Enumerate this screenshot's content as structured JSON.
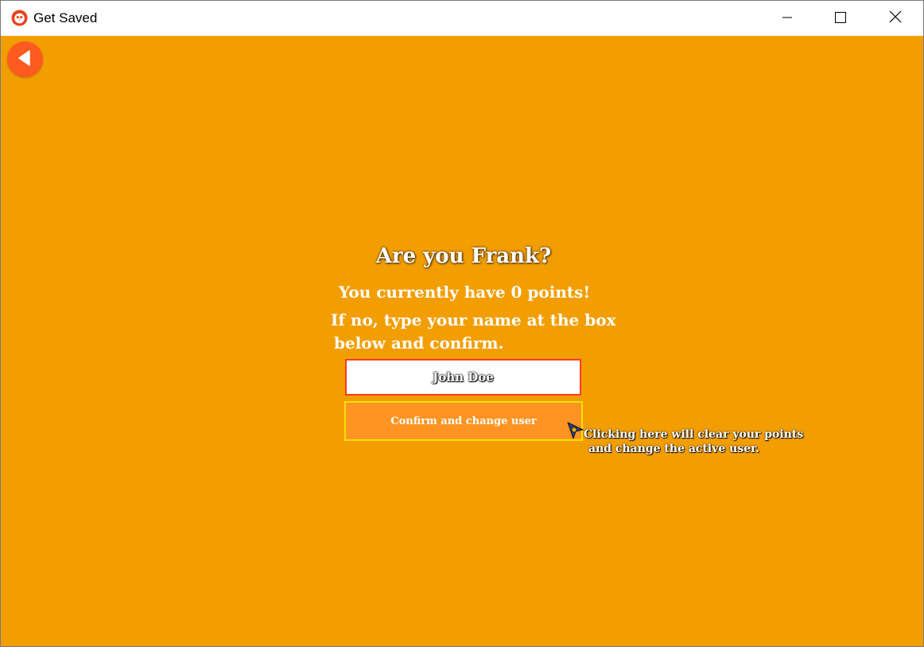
{
  "window": {
    "title": "Get Saved",
    "app_icon": "owl-logo-icon",
    "controls": [
      "minimize-icon",
      "maximize-icon",
      "close-icon"
    ]
  },
  "nav": {
    "back_icon": "back-arrow-icon"
  },
  "main": {
    "heading": "Are you Frank?",
    "points_text": "You currently have 0 points!",
    "instruction_line1": "If no, type your name at the box",
    "instruction_line2": "below and confirm.",
    "name_input": {
      "placeholder": "John Doe",
      "value": ""
    },
    "confirm_label": "Confirm and change user",
    "tooltip_line1": "Clicking here will clear your points",
    "tooltip_line2": "and change the active user."
  },
  "colors": {
    "background": "#f39e00",
    "back_button": "#ff5a1f",
    "input_border": "#ff3b2a",
    "confirm_button": "#ff9422",
    "confirm_border": "#f5e000"
  }
}
